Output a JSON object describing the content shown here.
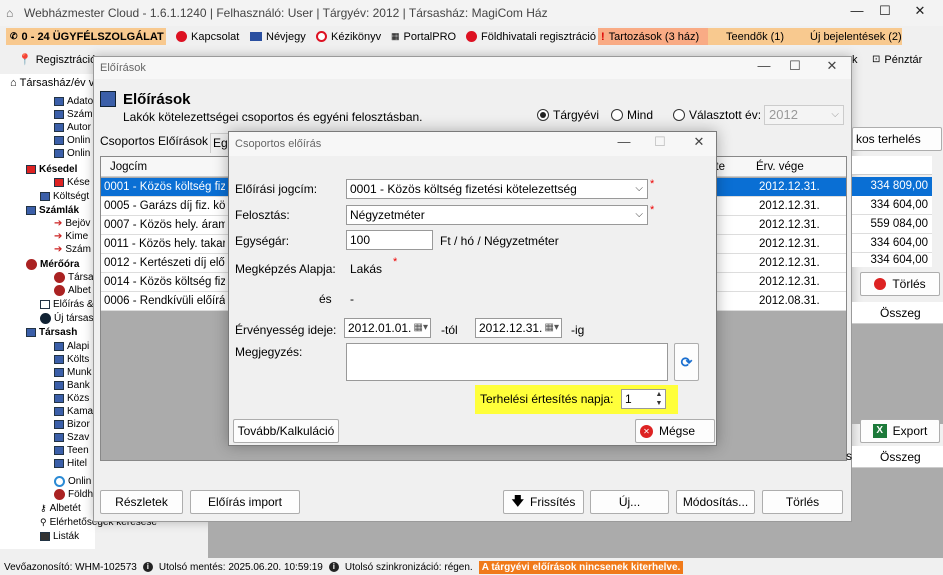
{
  "app": {
    "title": "Webházmester Cloud - 1.6.1.1240 | Felhasználó: User | Tárgyév: 2012 | Társasház: MagiCom Ház"
  },
  "menubar": {
    "items": [
      "0 - 24 ÜGYFÉLSZOLGÁLAT",
      "Kapcsolat",
      "Névjegy",
      "Kézikönyv",
      "PortalPRO",
      "Földhivatali regisztráció",
      "Tartozások (3 ház)",
      "Teendők (1)",
      "Új bejelentések (2)"
    ]
  },
  "toolbar2": {
    "registration": "Regisztráció",
    "right1": "k",
    "right2": "Pénztár"
  },
  "tree": {
    "items": [
      "Társasház/év v",
      "Adato",
      "Szám",
      "Autor",
      "Onlin",
      "Onlin",
      "Késedel",
      "Kése",
      "Költségt",
      "Számlák",
      "Bejöv",
      "Kime",
      "Szám",
      "Mérőóra",
      "Társa",
      "Albet",
      "Előírás &",
      "Új társas",
      "Társash",
      "Alapi",
      "Költs",
      "Munk",
      "Bank",
      "Közs",
      "Kama",
      "Bizor",
      "Szav",
      "Teen",
      "Hitel",
      "Onlin",
      "Földh",
      "Albetét",
      "Elérhetőségek keresése",
      "Listák"
    ]
  },
  "eloirasok": {
    "window_title": "Előírások",
    "heading": "Előírások",
    "subtitle": "Lakók kötelezettségei csoportos és egyéni felosztásban.",
    "radio_targyevi": "Tárgyévi",
    "radio_mind": "Mind",
    "radio_valasztott": "Választott év:",
    "year_value": "2012",
    "tab_csoportos": "Csoportos Előírások",
    "tab_eg": "Eg",
    "btn_kos_terheles": "kos terhelés",
    "columns": [
      "Jogcím",
      "ete",
      "Érv. vége"
    ],
    "rows": [
      {
        "jogcim": "0001 - Közös költség fizet",
        "vege": "2012.12.31.",
        "osszeg": "334 809,00"
      },
      {
        "jogcim": "0005 - Garázs díj fiz. kötel",
        "vege": "2012.12.31.",
        "osszeg": "334 604,00"
      },
      {
        "jogcim": "0007 - Közös hely. áramfo",
        "vege": "2012.12.31.",
        "osszeg": "559 084,00"
      },
      {
        "jogcim": "0011 - Közös hely. takarít",
        "vege": "2012.12.31.",
        "osszeg": "334 604,00"
      },
      {
        "jogcim": "0012 - Kertészeti díj előír",
        "vege": "2012.12.31.",
        "osszeg": "334 604,00"
      },
      {
        "jogcim": "0014 - Közös költség fiz.",
        "vege": "2012.12.31.",
        "osszeg": ""
      },
      {
        "jogcim": "0006 - Rendkívüli előírás",
        "vege": "2012.08.31.",
        "osszeg": ""
      }
    ],
    "btn_torles_right": "Törlés",
    "col_osszeg": "Összeg",
    "btn_export": "Export",
    "col_osszeg2": "Összeg",
    "col_s": "s",
    "btn_reszletek": "Részletek",
    "btn_eloiras_import": "Előírás import",
    "btn_frissites": "Frissítés",
    "btn_uj": "Új...",
    "btn_modositas": "Módosítás...",
    "btn_torles": "Törlés"
  },
  "dialog": {
    "title": "Csoportos előírás",
    "label_jogcim": "Előírási jogcím:",
    "value_jogcim": "0001 - Közös költség fizetési kötelezettség",
    "label_felosztas": "Felosztás:",
    "value_felosztas": "Négyzetméter",
    "label_egysegar": "Egységár:",
    "value_egysegar": "100",
    "unit_egysegar": "Ft / hó  / Négyzetméter",
    "label_megkepzes": "Megképzés Alapja:",
    "value_megkepzes": "Lakás",
    "label_es": "és",
    "value_es": "-",
    "label_ervenyesseg": "Érvényesség ideje:",
    "date_from": "2012.01.01.",
    "date_from_suffix": "-tól",
    "date_to": "2012.12.31.",
    "date_to_suffix": "-ig",
    "label_megjegyzes": "Megjegyzés:",
    "value_megjegyzes": "",
    "label_terhelesi": "Terhelési értesítés napja:",
    "value_terhelesi": "1",
    "btn_tovabb": "Tovább/Kalkuláció",
    "btn_megse": "Mégse"
  },
  "status": {
    "id": "Vevőazonosító: WHM-102573",
    "last_save": "Utolsó mentés: 2025.06.20. 10:59:19",
    "last_sync": "Utolsó szinkronizáció: régen.",
    "warning": "A tárgyévi előírások nincsenek kiterhelve."
  },
  "colors": {
    "selection": "#0a6fd4",
    "highlight": "#ffff3a",
    "warning_bg": "#f07a1a",
    "menu_orange": "#f8c98f",
    "menu_red": "#f9ab85"
  }
}
